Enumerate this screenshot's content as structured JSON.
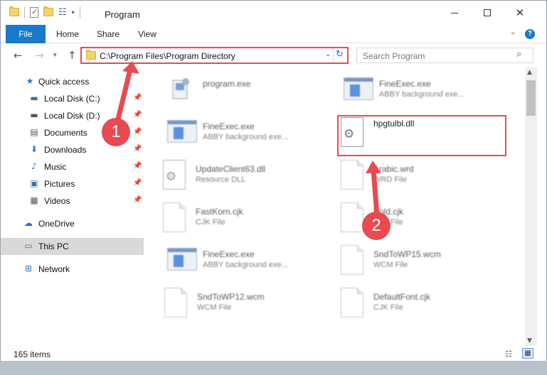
{
  "window": {
    "title": "Program",
    "qat_dropdown": "▾"
  },
  "ribbon": {
    "tabs": [
      "File",
      "Home",
      "Share",
      "View"
    ],
    "help": "?"
  },
  "address": {
    "path": "C:\\Program Files\\Program Directory",
    "search_placeholder": "Search Program"
  },
  "nav": {
    "quick_access": "Quick access",
    "items": [
      {
        "label": "Local Disk (C:)",
        "icon": "local-disk-icon",
        "pinned": true
      },
      {
        "label": "Local Disk (D:)",
        "icon": "local-disk-icon",
        "pinned": true
      },
      {
        "label": "Documents",
        "icon": "documents-icon",
        "pinned": true
      },
      {
        "label": "Downloads",
        "icon": "downloads-icon",
        "pinned": true
      },
      {
        "label": "Music",
        "icon": "music-icon",
        "pinned": true
      },
      {
        "label": "Pictures",
        "icon": "pictures-icon",
        "pinned": true
      },
      {
        "label": "Videos",
        "icon": "videos-icon",
        "pinned": true
      }
    ],
    "onedrive": "OneDrive",
    "this_pc": "This PC",
    "network": "Network"
  },
  "files": {
    "left": [
      {
        "name": "program.exe",
        "type": "",
        "icon": "exe-icon"
      },
      {
        "name": "FineExec.exe",
        "type": "ABBY background exe...",
        "icon": "app-icon"
      },
      {
        "name": "UpdateClient63.dll",
        "type": "Resource DLL",
        "icon": "dll-icon"
      },
      {
        "name": "FastKorn.cjk",
        "type": "CJK File",
        "icon": "doc-icon"
      },
      {
        "name": "FineExec.exe",
        "type": "ABBY background exe...",
        "icon": "app-icon"
      },
      {
        "name": "SndToWP12.wcm",
        "type": "WCM File",
        "icon": "doc-icon"
      }
    ],
    "right": [
      {
        "name": "FineExec.exe",
        "type": "ABBY background exe...",
        "icon": "app-icon"
      },
      {
        "name": "hpgtulbl.dll",
        "type": "",
        "icon": "gear-dll-icon"
      },
      {
        "name": "Arabic.wrd",
        "type": "WRD File",
        "icon": "doc-icon"
      },
      {
        "name": "Bold.cjk",
        "type": "CJK File",
        "icon": "doc-icon"
      },
      {
        "name": "SndToWP15.wcm",
        "type": "WCM File",
        "icon": "doc-icon"
      },
      {
        "name": "DefaultFont.cjk",
        "type": "CJK File",
        "icon": "doc-icon"
      }
    ]
  },
  "status": {
    "item_count": "165 items"
  },
  "callouts": [
    "1",
    "2"
  ],
  "colors": {
    "accent": "#1979ca",
    "highlight": "#e84a50"
  }
}
